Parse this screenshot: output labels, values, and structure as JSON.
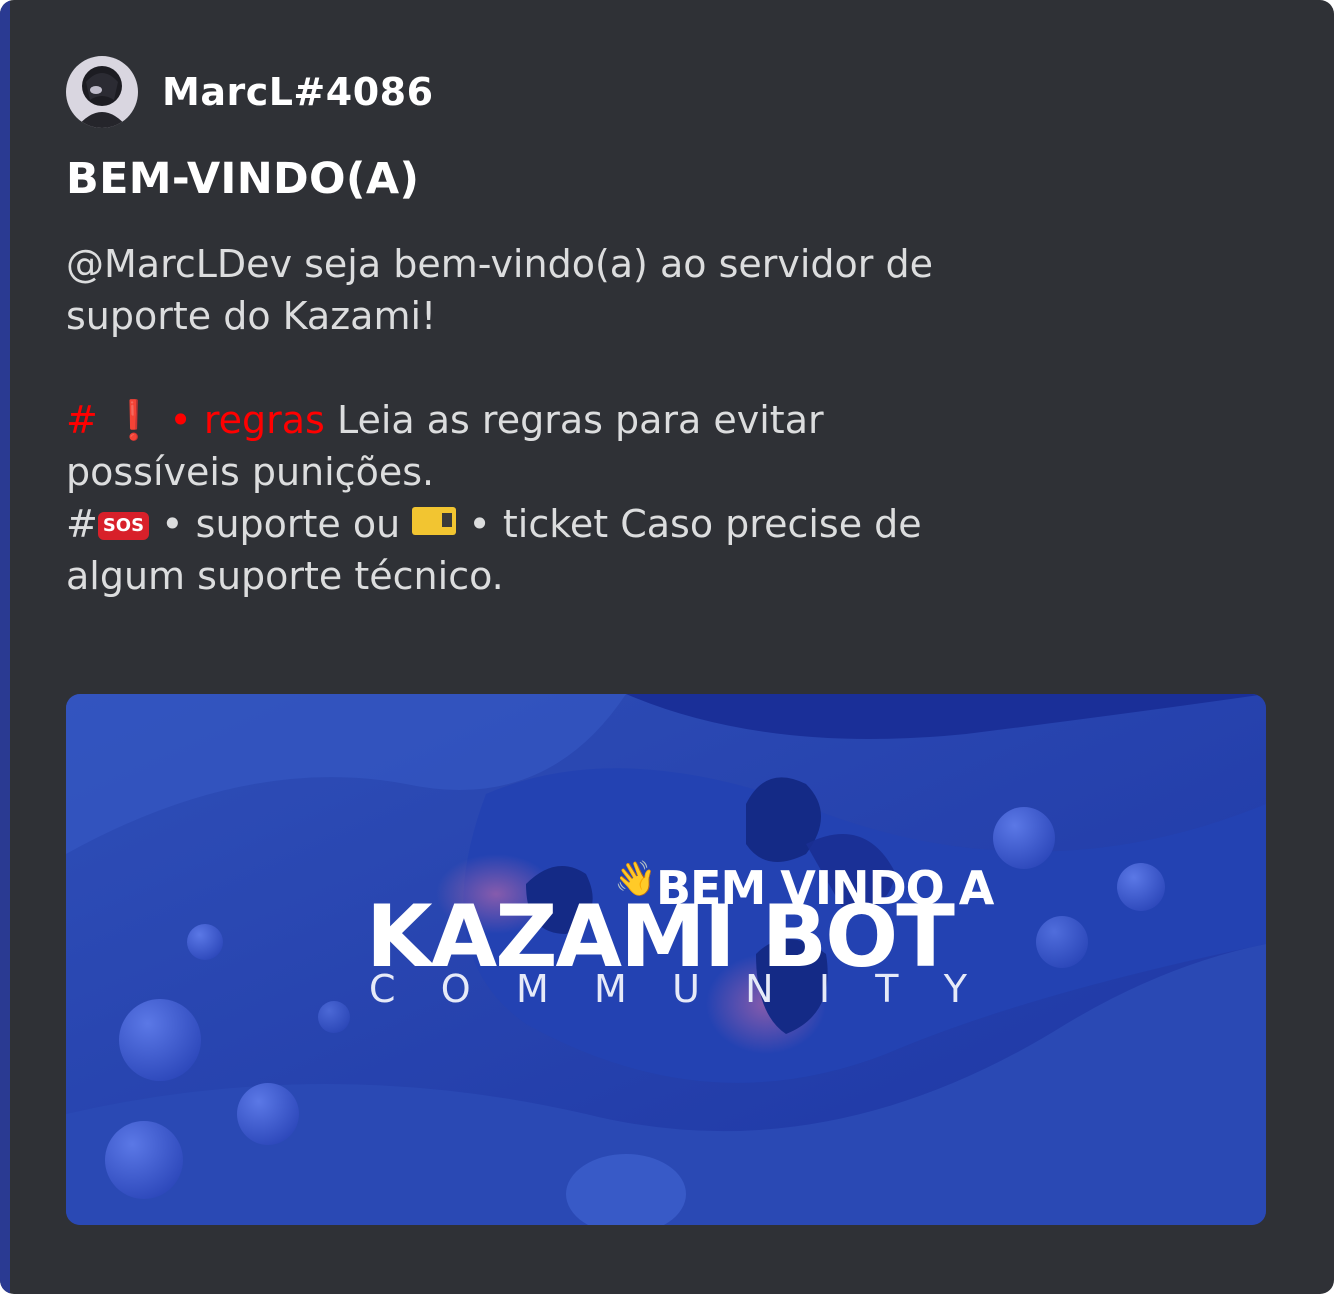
{
  "author": {
    "name": "MarcL#4086"
  },
  "embed": {
    "title": "BEM-VINDO(A)",
    "description": {
      "intro": "@MarcLDev seja bem-vindo(a) ao servidor de suporte do Kazami!",
      "rules_hash": "#",
      "rules_icon": "❗",
      "rules_channel": "• regras",
      "rules_text": " Leia as regras para evitar possíveis punições.",
      "support_hash": "#",
      "sos_icon": "SOS",
      "support_channel": " • suporte ou ",
      "ticket_channel": " • ticket",
      "support_text": " Caso precise de algum suporte técnico."
    }
  },
  "banner": {
    "wave_icon": "👋",
    "line1": "BEM VINDO A",
    "line2": "KAZAMI BOT",
    "line3": "C O M M U N I T Y"
  },
  "colors": {
    "embed_bg": "#2f3136",
    "accent_bar": "#2a3a92",
    "mention_red": "#ff0000",
    "banner_blue": "#1c3aa6"
  }
}
